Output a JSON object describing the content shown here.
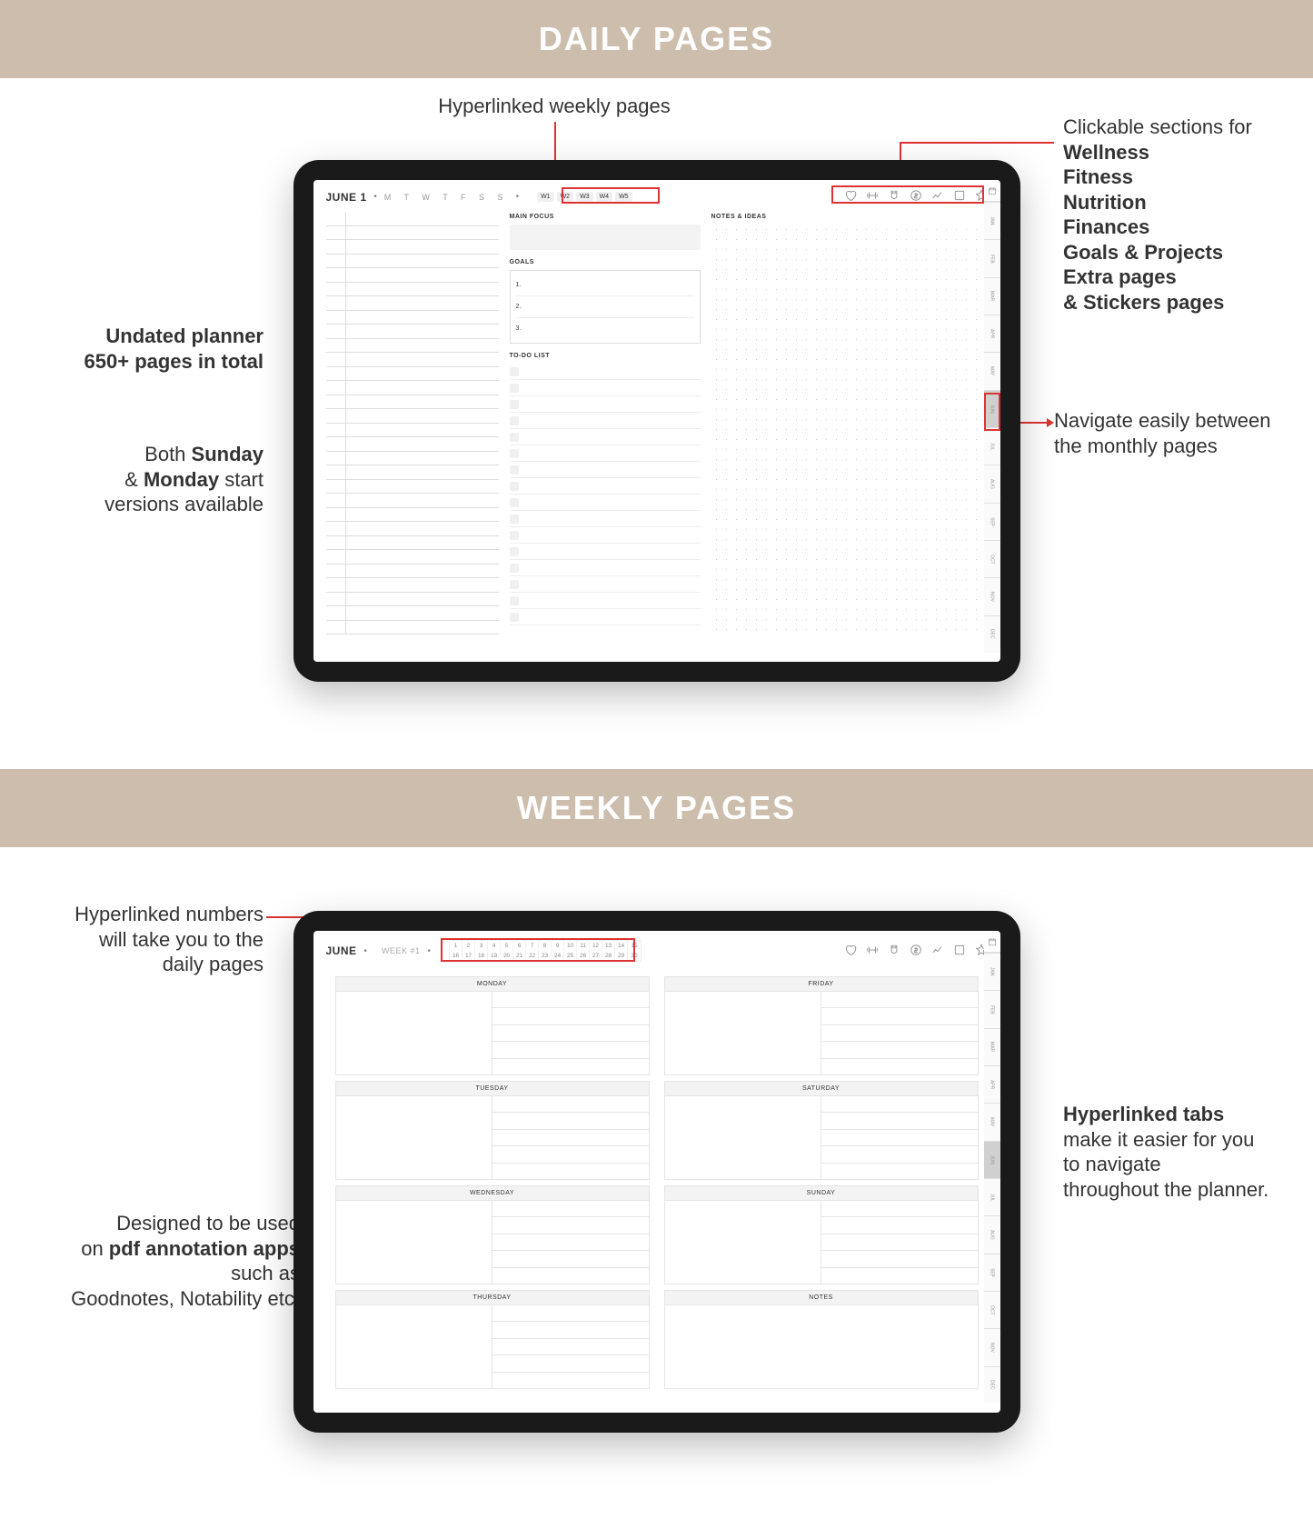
{
  "banners": {
    "daily": "DAILY PAGES",
    "weekly": "WEEKLY PAGES"
  },
  "daily": {
    "month": "JUNE",
    "day": "1",
    "weekdays": "M T W T F S S",
    "weeks": [
      "W1",
      "W2",
      "W3",
      "W4",
      "W5"
    ],
    "mainFocusLabel": "MAIN FOCUS",
    "goalsLabel": "GOALS",
    "goals": [
      "1.",
      "2.",
      "3."
    ],
    "todoLabel": "TO-DO LIST",
    "notesLabel": "NOTES & IDEAS",
    "tabs": [
      "JAN",
      "FEB",
      "MAR",
      "APR",
      "MAY",
      "JUN",
      "JUL",
      "AUG",
      "SEP",
      "OCT",
      "NOV",
      "DEC"
    ]
  },
  "weekly": {
    "month": "JUNE",
    "weekLabel": "WEEK #1",
    "datesRow1": [
      "1",
      "2",
      "3",
      "4",
      "5",
      "6",
      "7",
      "8",
      "9",
      "10",
      "11",
      "12",
      "13",
      "14",
      "15"
    ],
    "datesRow2": [
      "16",
      "17",
      "18",
      "19",
      "20",
      "21",
      "22",
      "23",
      "24",
      "25",
      "26",
      "27",
      "28",
      "29",
      "30"
    ],
    "days": {
      "mon": "MONDAY",
      "tue": "TUESDAY",
      "wed": "WEDNESDAY",
      "thu": "THURSDAY",
      "fri": "FRIDAY",
      "sat": "SATURDAY",
      "sun": "SUNDAY",
      "notes": "NOTES"
    },
    "tabs": [
      "JAN",
      "FEB",
      "MAR",
      "APR",
      "MAY",
      "JUN",
      "JUL",
      "AUG",
      "SEP",
      "OCT",
      "NOV",
      "DEC"
    ]
  },
  "callouts": {
    "hyperWeekly": "Hyperlinked weekly pages",
    "clickableIntro": "Clickable sections for",
    "clickableList": [
      "Wellness",
      "Fitness",
      "Nutrition",
      "Finances",
      "Goals & Projects",
      "Extra pages",
      "& Stickers pages"
    ],
    "undated1": "Undated planner",
    "undated2": "650+ pages in total",
    "startversions_html": "Both <b>Sunday</b><br>& <b>Monday</b> start<br>versions available",
    "navigate1": "Navigate easily between",
    "navigate2": "the monthly pages",
    "hyperNumbers1": "Hyperlinked numbers",
    "hyperNumbers2": "will take you to the",
    "hyperNumbers3": "daily pages",
    "hyperTabs_html": "<b>Hyperlinked tabs</b><br>make it easier for you<br>to navigate<br>throughout the planner.",
    "designed_html": "Designed to be used<br>on <b>pdf annotation apps</b><br>such as<br>Goodnotes, Notability etc."
  }
}
